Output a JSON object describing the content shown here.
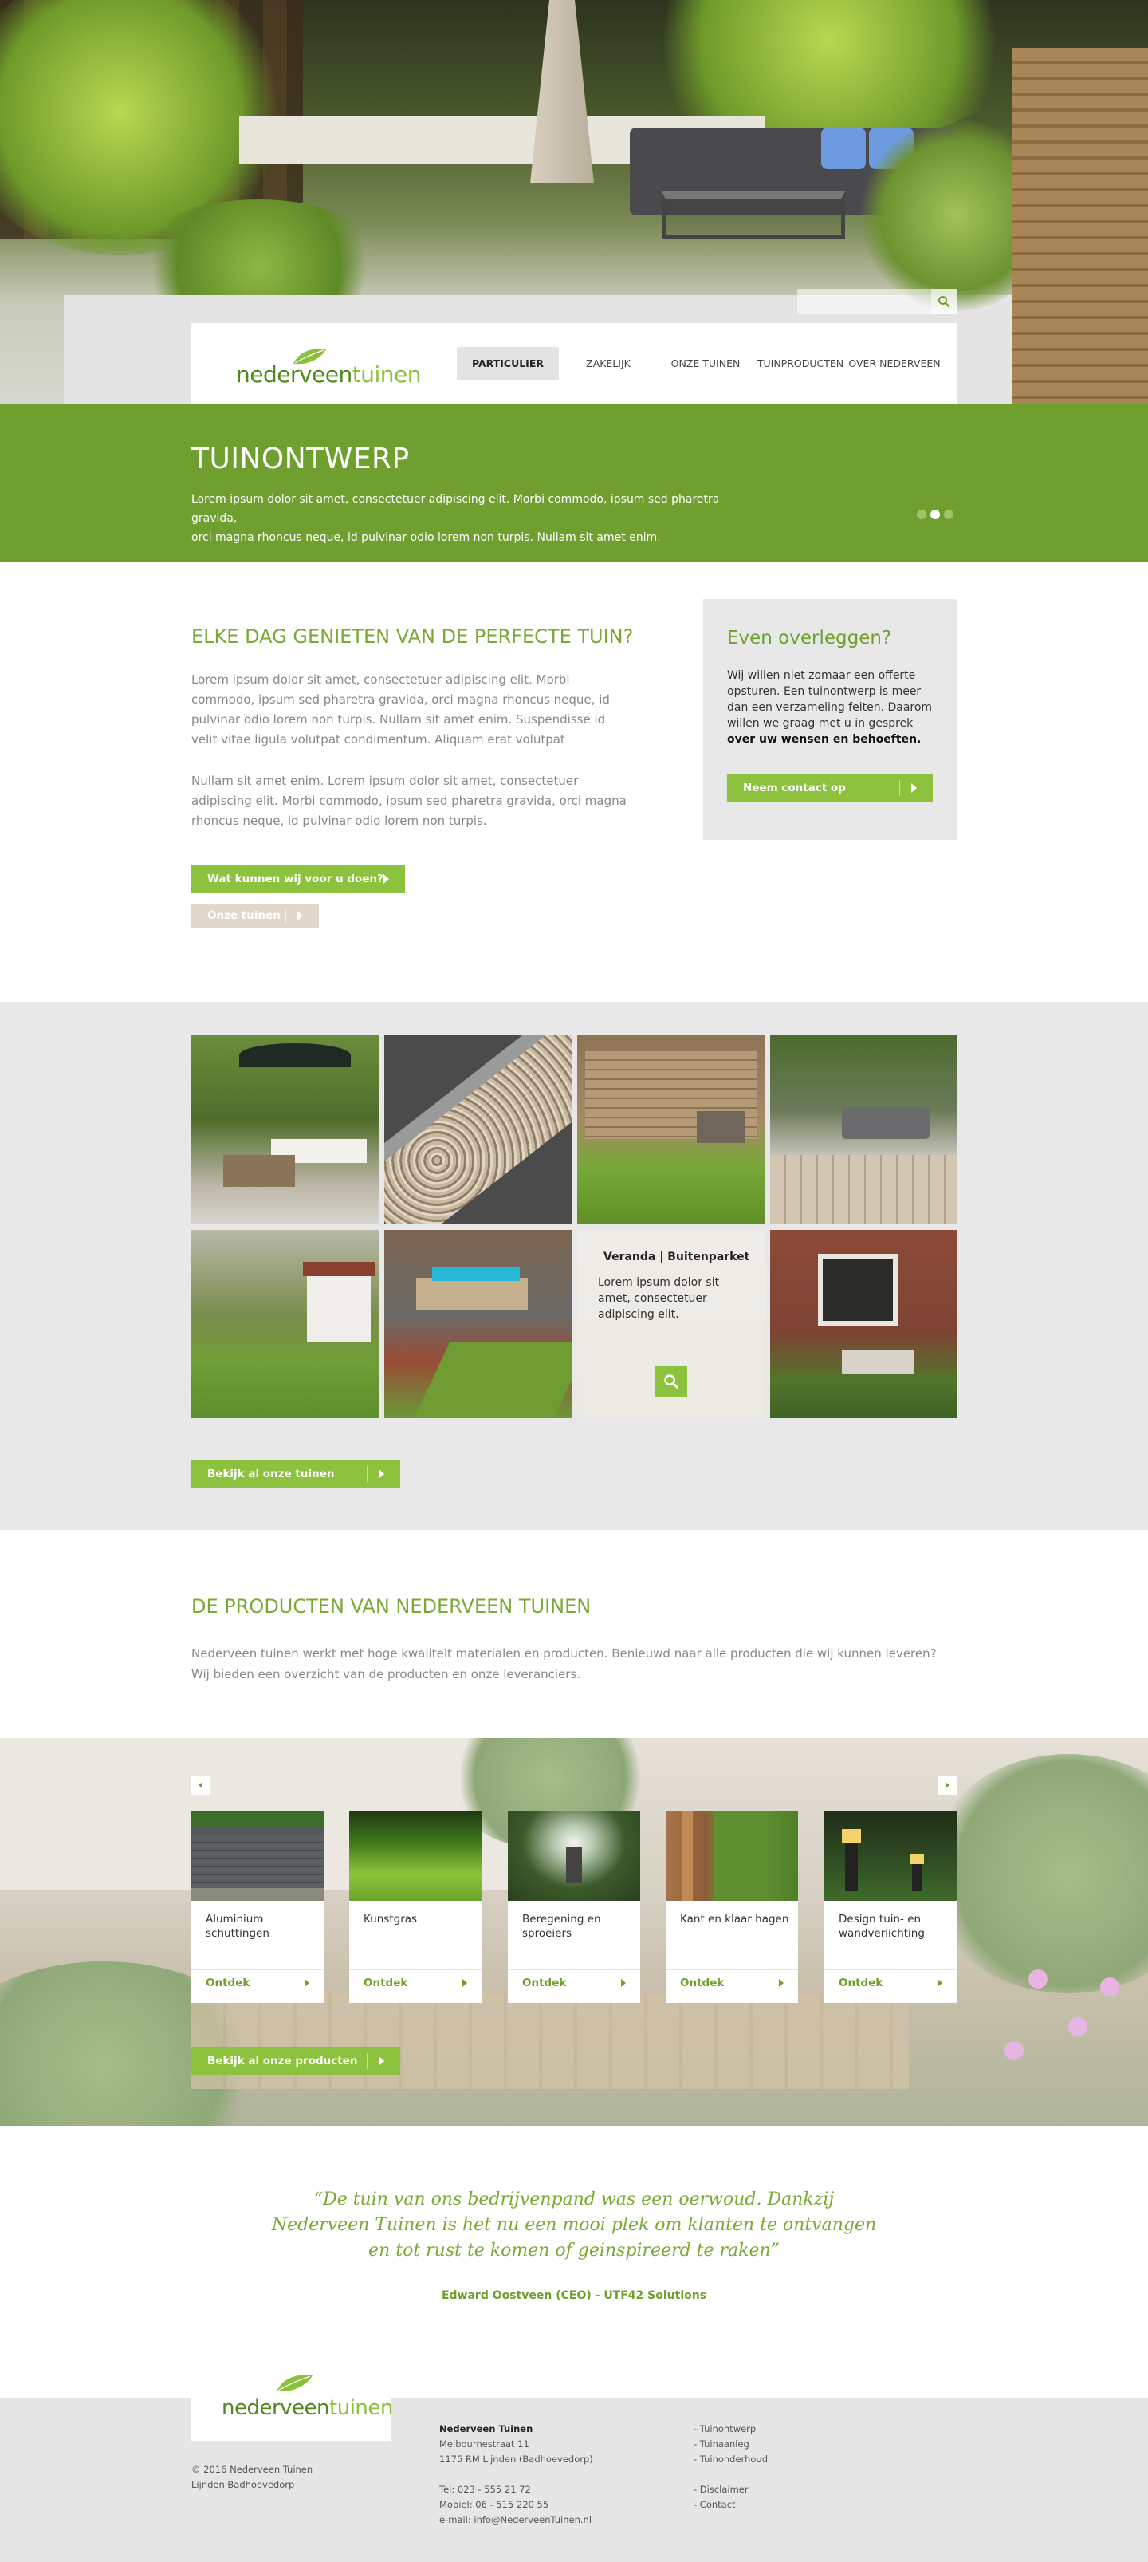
{
  "search": {
    "placeholder": ""
  },
  "brand": {
    "logo_part1": "nederveen",
    "logo_part2": "tuinen",
    "green": "#6e9f2f",
    "accent": "#8cc23e"
  },
  "nav": {
    "items": [
      "PARTICULIER",
      "ZAKELIJK",
      "ONZE TUINEN",
      "TUINPRODUCTEN",
      "OVER NEDERVEEN"
    ],
    "active": "PARTICULIER"
  },
  "hero_band": {
    "title": "TUINONTWERP",
    "text_line1": "Lorem ipsum dolor sit amet, consectetuer adipiscing elit. Morbi commodo, ipsum sed pharetra gravida,",
    "text_line2": "orci magna rhoncus neque, id pulvinar odio lorem non turpis. Nullam sit amet enim.",
    "slider_total": 3,
    "slider_active": 2
  },
  "intro": {
    "heading": "ELKE DAG GENIETEN VAN DE PERFECTE TUIN?",
    "paragraph1": "Lorem ipsum dolor sit amet, consectetuer adipiscing elit. Morbi commodo, ipsum sed pharetra gravida, orci magna rhoncus neque, id pulvinar odio lorem non turpis. Nullam sit amet enim. Suspendisse id velit vitae ligula volutpat condimentum. Aliquam erat volutpat",
    "paragraph2": "Nullam sit amet enim. Lorem ipsum dolor sit amet, consectetuer adipiscing elit. Morbi commodo, ipsum sed pharetra gravida, orci magna rhoncus neque, id pulvinar odio lorem non turpis.",
    "button_primary": "Wat kunnen wij voor u doen?",
    "button_secondary": "Onze tuinen"
  },
  "aside": {
    "heading": "Even overleggen?",
    "text": "Wij willen niet zomaar een offerte opsturen. Een tuinontwerp is meer dan een verzameling feiten. Daarom willen we graag met u in gesprek",
    "text_bold": "over uw wensen en behoeften.",
    "button": "Neem contact op"
  },
  "gallery": {
    "hover_title": "Veranda | Buitenparket",
    "hover_text": "Lorem ipsum dolor sit amet, consectetuer adipiscing elit.",
    "button": "Bekijk al onze tuinen"
  },
  "products": {
    "heading": "DE PRODUCTEN VAN NEDERVEEN TUINEN",
    "text": "Nederveen tuinen werkt met hoge kwaliteit materialen en producten. Benieuwd naar alle producten die wij kunnen leveren? Wij bieden een overzicht van de producten en onze leveranciers.",
    "cards": [
      {
        "label": "Aluminium schuttingen",
        "action": "Ontdek"
      },
      {
        "label": "Kunstgras",
        "action": "Ontdek"
      },
      {
        "label": "Beregening en sproeiers",
        "action": "Ontdek"
      },
      {
        "label": "Kant en klaar hagen",
        "action": "Ontdek"
      },
      {
        "label": "Design tuin- en wandverlichting",
        "action": "Ontdek"
      }
    ],
    "button": "Bekijk al onze producten"
  },
  "testimonial": {
    "quote_line1": "“De tuin van ons bedrijvenpand was een oerwoud. Dankzij",
    "quote_line2": "Nederveen Tuinen is het nu een mooi plek om klanten te ontvangen",
    "quote_line3": "en tot rust te komen of geinspireerd te raken”",
    "author": "Edward Oostveen (CEO) - UTF42 Solutions"
  },
  "footer": {
    "copyright": "© 2016 Nederveen Tuinen",
    "location": "Lijnden Badhoevedorp",
    "company": "Nederveen Tuinen",
    "street": "Melbournestraat 11",
    "city": "1175 RM Lijnden (Badhoevedorp)",
    "tel": "Tel: 023 - 555 21 72",
    "mobile": "Mobiel: 06 - 515 220 55",
    "email": "e-mail: info@NederveenTuinen.nl",
    "links1": [
      "- Tuinontwerp",
      "- Tuinaanleg",
      "- Tuinonderhoud"
    ],
    "links2": [
      "- Disclaimer",
      "- Contact"
    ]
  }
}
